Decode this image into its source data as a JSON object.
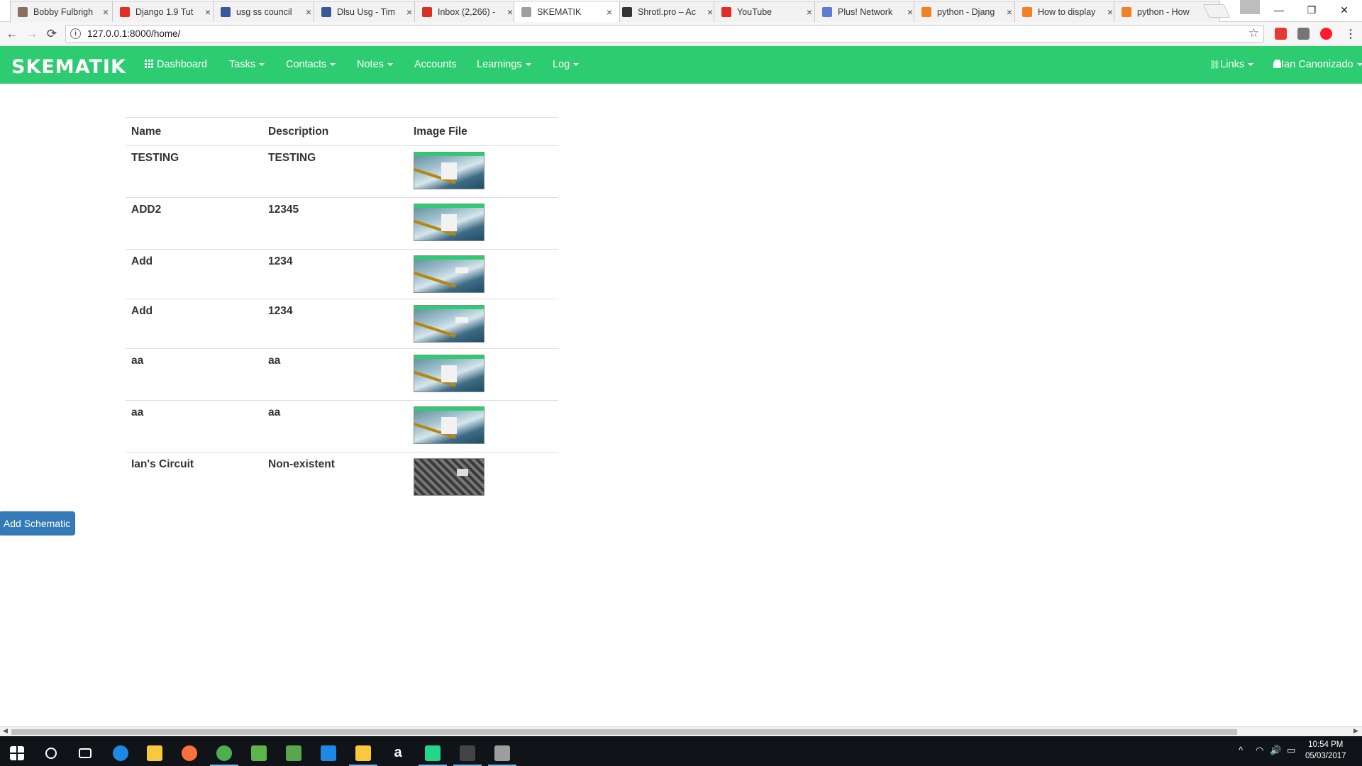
{
  "browser": {
    "tabs": [
      {
        "title": "Bobby Fulbrigh",
        "color": "#8d6e63"
      },
      {
        "title": "Django 1.9 Tut",
        "color": "#e52d27"
      },
      {
        "title": "usg ss council",
        "color": "#3b5998"
      },
      {
        "title": "Dlsu Usg - Tim",
        "color": "#3b5998"
      },
      {
        "title": "Inbox (2,266) -",
        "color": "#d93025"
      },
      {
        "title": "SKEMATIK",
        "color": "#9e9e9e"
      },
      {
        "title": "Shrotl.pro – Ac",
        "color": "#333333"
      },
      {
        "title": "YouTube",
        "color": "#e52d27"
      },
      {
        "title": "Plus! Network",
        "color": "#5b7bd5"
      },
      {
        "title": "python - Djang",
        "color": "#f48024"
      },
      {
        "title": "How to display",
        "color": "#f48024"
      },
      {
        "title": "python - How",
        "color": "#f48024"
      }
    ],
    "url": "127.0.0.1:8000/home/",
    "icons": {
      "back": "←",
      "forward": "→",
      "reload": "⟳",
      "info": "i",
      "star": "☆",
      "minimize": "—",
      "restore": "❐",
      "close": "✕",
      "menu": "⋮",
      "tab_close": "×"
    },
    "extension_colors": [
      "#e53935",
      "#757575",
      "#ff1b2d"
    ]
  },
  "navbar": {
    "brand": "SKEMATIK",
    "color": "#2ecc71",
    "items": [
      {
        "label": "Dashboard",
        "dropdown": false
      },
      {
        "label": "Tasks",
        "dropdown": true
      },
      {
        "label": "Contacts",
        "dropdown": true
      },
      {
        "label": "Notes",
        "dropdown": true
      },
      {
        "label": "Accounts",
        "dropdown": false
      },
      {
        "label": "Learnings",
        "dropdown": true
      },
      {
        "label": "Log",
        "dropdown": true
      }
    ],
    "links_label": "Links",
    "user_label": "Ian Canonizado",
    "icons": {
      "link": "🔗",
      "user": "👤"
    }
  },
  "table": {
    "headers": [
      "Name",
      "Description",
      "Image File"
    ],
    "rows": [
      {
        "name": "TESTING",
        "description": "TESTING",
        "thumb": "landscape"
      },
      {
        "name": "ADD2",
        "description": "12345",
        "thumb": "landscape"
      },
      {
        "name": "Add",
        "description": "1234",
        "thumb": "landscape-alt"
      },
      {
        "name": "Add",
        "description": "1234",
        "thumb": "landscape-alt"
      },
      {
        "name": "aa",
        "description": "aa",
        "thumb": "landscape"
      },
      {
        "name": "aa",
        "description": "aa",
        "thumb": "landscape"
      },
      {
        "name": "Ian's Circuit",
        "description": "Non-existent",
        "thumb": "circuit"
      }
    ]
  },
  "add_button": {
    "label": "Add Schematic",
    "color": "#337ab7"
  },
  "scrollbar": {
    "left_arrow": "◀",
    "right_arrow": "▶"
  },
  "taskbar": {
    "apps": [
      {
        "name": "start",
        "color": "#ffffff",
        "running": false
      },
      {
        "name": "search",
        "color": "#ffffff",
        "running": false
      },
      {
        "name": "task-view",
        "color": "#ffffff",
        "running": false
      },
      {
        "name": "edge",
        "color": "#1e88e5",
        "running": false
      },
      {
        "name": "file-explorer",
        "color": "#f9c83e",
        "running": false
      },
      {
        "name": "firefox",
        "color": "#ff7139",
        "running": false
      },
      {
        "name": "chrome",
        "color": "#4caf50",
        "running": true
      },
      {
        "name": "photos",
        "color": "#5db44b",
        "running": false
      },
      {
        "name": "notepad",
        "color": "#56a84a",
        "running": false
      },
      {
        "name": "store",
        "color": "#1e88e5",
        "running": false
      },
      {
        "name": "folder",
        "color": "#f9c83e",
        "running": true
      },
      {
        "name": "amazon",
        "color": "#ffffff",
        "running": false
      },
      {
        "name": "pycharm",
        "color": "#21d789",
        "running": true
      },
      {
        "name": "terminal",
        "color": "#444444",
        "running": true
      },
      {
        "name": "database",
        "color": "#9e9e9e",
        "running": true
      }
    ],
    "tray": {
      "chevron": "^",
      "wifi": "◠",
      "volume": "🔊",
      "notifications": "▭"
    },
    "time": "10:54 PM",
    "date": "05/03/2017"
  }
}
